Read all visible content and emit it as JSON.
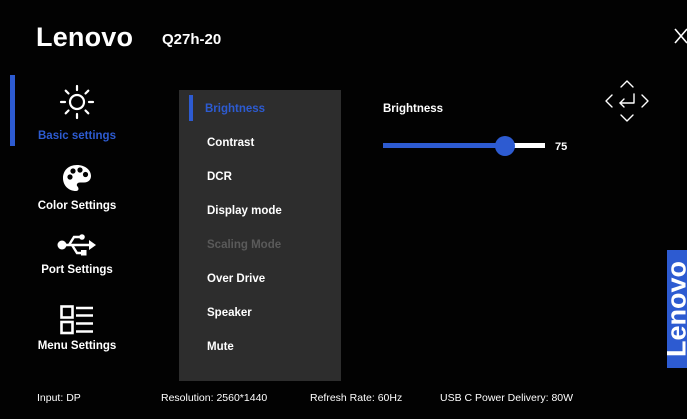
{
  "header": {
    "brand": "Lenovo",
    "model": "Q27h-20"
  },
  "sidebar": {
    "items": [
      {
        "label": "Basic settings",
        "icon": "brightness-icon",
        "active": true
      },
      {
        "label": "Color Settings",
        "icon": "palette-icon",
        "active": false
      },
      {
        "label": "Port Settings",
        "icon": "usb-icon",
        "active": false
      },
      {
        "label": "Menu Settings",
        "icon": "menu-list-icon",
        "active": false
      }
    ]
  },
  "menu": {
    "items": [
      {
        "label": "Brightness",
        "state": "selected"
      },
      {
        "label": "Contrast",
        "state": "normal"
      },
      {
        "label": "DCR",
        "state": "normal"
      },
      {
        "label": "Display mode",
        "state": "normal"
      },
      {
        "label": "Scaling Mode",
        "state": "disabled"
      },
      {
        "label": "Over Drive",
        "state": "normal"
      },
      {
        "label": "Speaker",
        "state": "normal"
      },
      {
        "label": "Mute",
        "state": "normal"
      }
    ]
  },
  "detail": {
    "title": "Brightness",
    "slider": {
      "min": 0,
      "max": 100,
      "value": 75,
      "value_label": "75"
    }
  },
  "side_logo": "Lenovo",
  "footer": {
    "input": "Input: DP",
    "resolution": "Resolution: 2560*1440",
    "refresh": "Refresh Rate: 60Hz",
    "usb_power": "USB C Power Delivery: 80W"
  },
  "colors": {
    "accent": "#2d5bd1",
    "panel": "#2d2d2d",
    "background": "#020202",
    "disabled": "#5a5a5a"
  }
}
